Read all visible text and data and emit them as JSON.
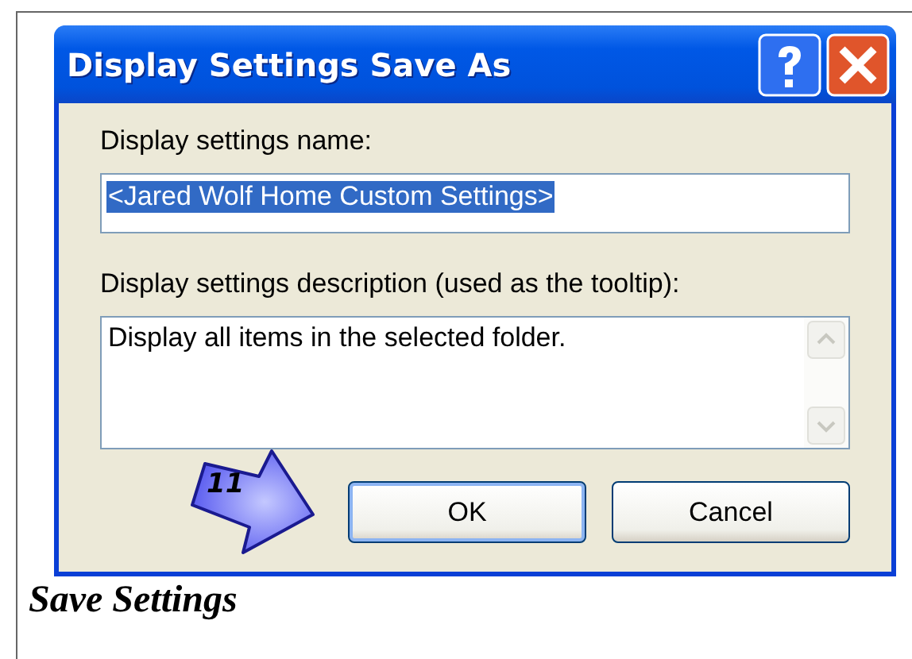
{
  "dialog": {
    "title": "Display Settings Save As",
    "name_field": {
      "label": "Display settings name:",
      "value": "<Jared Wolf Home Custom Settings>",
      "selected": true
    },
    "description_field": {
      "label": "Display settings description (used as the tooltip):",
      "value": "Display all items in the selected folder."
    },
    "buttons": [
      {
        "label": "OK",
        "default": true
      },
      {
        "label": "Cancel",
        "default": false
      }
    ],
    "callout": {
      "number": "11"
    }
  },
  "caption": "Save Settings"
}
